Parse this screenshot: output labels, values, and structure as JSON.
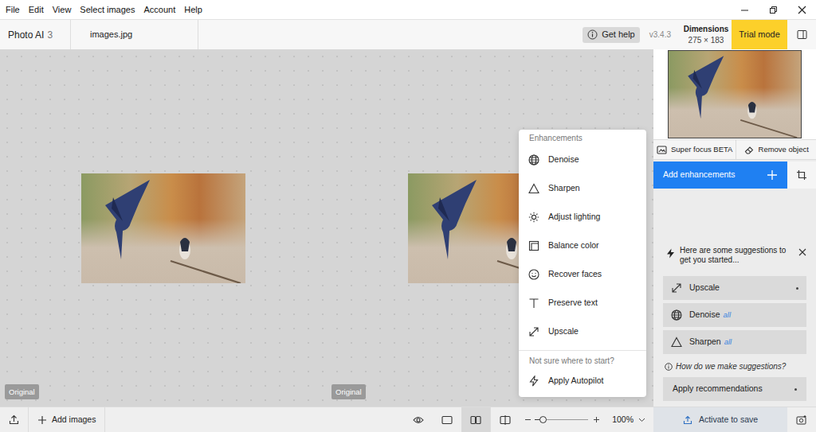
{
  "menu_bar": {
    "items": [
      "File",
      "Edit",
      "View",
      "Select images",
      "Account",
      "Help"
    ]
  },
  "toolbar": {
    "app_name": "Photo AI",
    "app_badge": "3",
    "file_name": "images.jpg",
    "help_button": "Get help",
    "version": "v3.4.3",
    "dimensions_label": "Dimensions",
    "dimensions_value": "275 × 183",
    "trial_badge": "Trial mode"
  },
  "canvas": {
    "panes": [
      {
        "label": "Original"
      },
      {
        "label": "Original"
      }
    ]
  },
  "enhancements_menu": {
    "heading": "Enhancements",
    "items": [
      {
        "label": "Denoise",
        "kind": "denoise"
      },
      {
        "label": "Sharpen",
        "kind": "sharpen"
      },
      {
        "label": "Adjust lighting",
        "kind": "lighting"
      },
      {
        "label": "Balance color",
        "kind": "color"
      },
      {
        "label": "Recover faces",
        "kind": "faces"
      },
      {
        "label": "Preserve text",
        "kind": "text"
      },
      {
        "label": "Upscale",
        "kind": "upscale"
      }
    ],
    "hint": "Not sure where to start?",
    "autopilot": {
      "label": "Apply Autopilot",
      "kind": "autopilot"
    }
  },
  "sidebar": {
    "tools": [
      {
        "label": "Super focus BETA",
        "kind": "focus"
      },
      {
        "label": "Remove object",
        "kind": "eraser"
      }
    ],
    "add_enhancements": "Add enhancements",
    "suggestions": {
      "intro": "Here are some suggestions to get you started...",
      "items": [
        {
          "label": "Upscale",
          "kind": "upscale",
          "scope": "",
          "pending": true
        },
        {
          "label": "Denoise",
          "kind": "denoise",
          "scope": "all",
          "pending": false
        },
        {
          "label": "Sharpen",
          "kind": "sharpen",
          "scope": "all",
          "pending": false
        }
      ],
      "help_link": "How do we make suggestions?",
      "apply_button": {
        "label": "Apply recommendations",
        "pending": true
      }
    }
  },
  "bottom_bar": {
    "add_images": "Add images",
    "view_modes": [
      {
        "kind": "preview",
        "selected": false
      },
      {
        "kind": "single",
        "selected": false
      },
      {
        "kind": "split",
        "selected": true
      },
      {
        "kind": "compare",
        "selected": false
      }
    ],
    "zoom": {
      "level": 0.14,
      "reading": "100%"
    },
    "activate_button": "Activate to save"
  }
}
